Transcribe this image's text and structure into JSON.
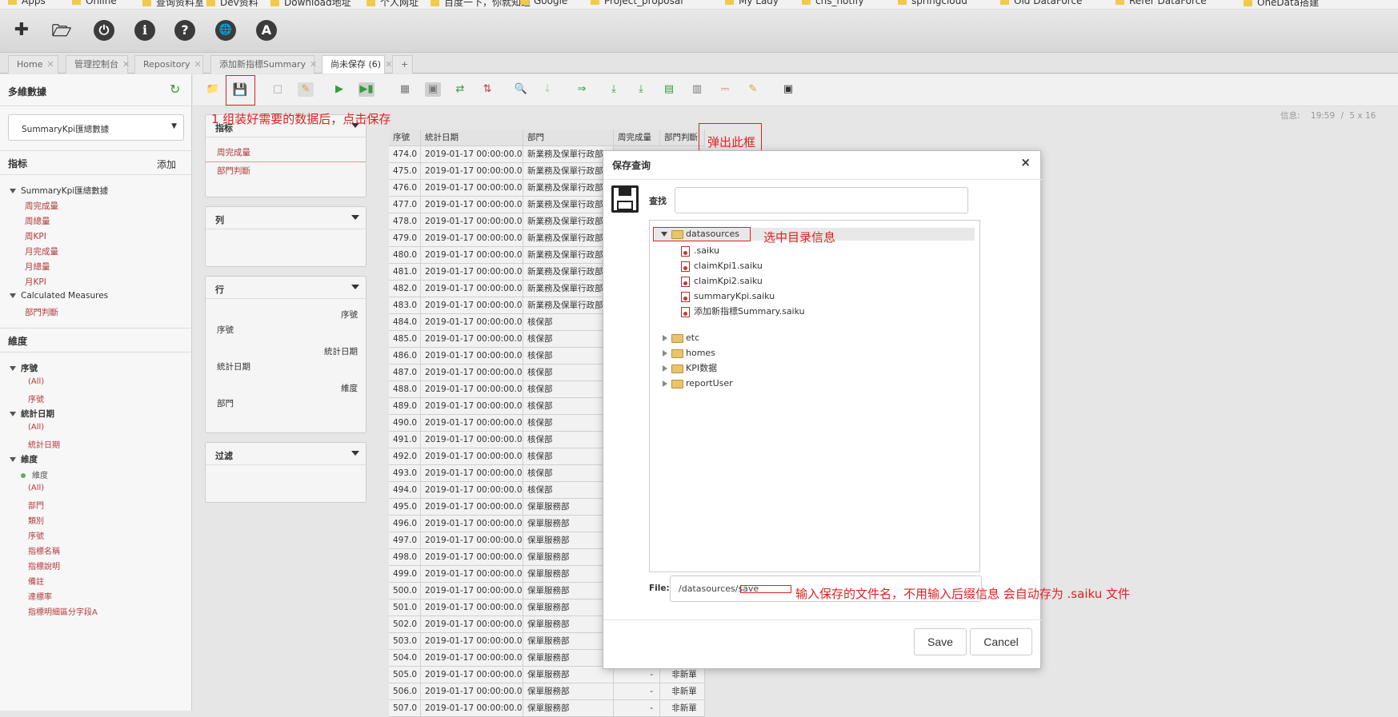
{
  "bookmarks": [
    "Apps",
    "Online",
    "查询资料室",
    "Dev资料",
    "Download地址",
    "个人网址",
    "百度一下，你就知道",
    "Google",
    "Project_proposal",
    "My Lady",
    "cns_notify",
    "springcloud",
    "Old DataForce",
    "Refer DataForce",
    "OneData搭建"
  ],
  "tabs": [
    {
      "label": "Home"
    },
    {
      "label": "管理控制台"
    },
    {
      "label": "Repository"
    },
    {
      "label": "添加新指標Summary"
    },
    {
      "label": "尚未保存 (6)"
    },
    {
      "label": "+"
    }
  ],
  "left": {
    "title": "多維數據",
    "cube_select": "SummaryKpi匯總數據",
    "measures_title": "指标",
    "add_label": "添加",
    "measures_group": "SummaryKpi匯總數據",
    "measures": [
      "周完成量",
      "周總量",
      "周KPI",
      "月完成量",
      "月總量",
      "月KPI"
    ],
    "calc_group": "Calculated Measures",
    "calc_items": [
      "部門判斷"
    ],
    "dims_title": "維度",
    "dims": [
      {
        "name": "序號",
        "items": [
          "(All)",
          "序號"
        ]
      },
      {
        "name": "統計日期",
        "items": [
          "(All)",
          "統計日期"
        ]
      },
      {
        "name": "維度",
        "items": [
          "維度",
          "(All)",
          "部門",
          "類別",
          "序號",
          "指標名稱",
          "指標說明",
          "備註",
          "達標率",
          "指標明細區分字段A"
        ]
      }
    ]
  },
  "panels": {
    "measures": {
      "title": "指标",
      "items": [
        "周完成量",
        "部門判斷"
      ]
    },
    "columns": {
      "title": "列"
    },
    "rows": {
      "title": "行",
      "items": [
        {
          "hier": "序號",
          "level": "序號"
        },
        {
          "hier": "統計日期",
          "level": "統計日期"
        },
        {
          "hier": "維度",
          "level": "部門"
        }
      ]
    },
    "filter": {
      "title": "过滤"
    }
  },
  "info": {
    "label": "信息:",
    "time": "19:59",
    "size": "5 x 16"
  },
  "grid": {
    "headers": [
      "序號",
      "統計日期",
      "部門",
      "周完成量",
      "部門判斷"
    ],
    "rows": [
      [
        "474.0",
        "2019-01-17 00:00:00.0",
        "新業務及保單行政部"
      ],
      [
        "475.0",
        "2019-01-17 00:00:00.0",
        "新業務及保單行政部"
      ],
      [
        "476.0",
        "2019-01-17 00:00:00.0",
        "新業務及保單行政部"
      ],
      [
        "477.0",
        "2019-01-17 00:00:00.0",
        "新業務及保單行政部"
      ],
      [
        "478.0",
        "2019-01-17 00:00:00.0",
        "新業務及保單行政部"
      ],
      [
        "479.0",
        "2019-01-17 00:00:00.0",
        "新業務及保單行政部"
      ],
      [
        "480.0",
        "2019-01-17 00:00:00.0",
        "新業務及保單行政部"
      ],
      [
        "481.0",
        "2019-01-17 00:00:00.0",
        "新業務及保單行政部"
      ],
      [
        "482.0",
        "2019-01-17 00:00:00.0",
        "新業務及保單行政部"
      ],
      [
        "483.0",
        "2019-01-17 00:00:00.0",
        "新業務及保單行政部"
      ],
      [
        "484.0",
        "2019-01-17 00:00:00.0",
        "核保部"
      ],
      [
        "485.0",
        "2019-01-17 00:00:00.0",
        "核保部"
      ],
      [
        "486.0",
        "2019-01-17 00:00:00.0",
        "核保部"
      ],
      [
        "487.0",
        "2019-01-17 00:00:00.0",
        "核保部"
      ],
      [
        "488.0",
        "2019-01-17 00:00:00.0",
        "核保部"
      ],
      [
        "489.0",
        "2019-01-17 00:00:00.0",
        "核保部"
      ],
      [
        "490.0",
        "2019-01-17 00:00:00.0",
        "核保部"
      ],
      [
        "491.0",
        "2019-01-17 00:00:00.0",
        "核保部"
      ],
      [
        "492.0",
        "2019-01-17 00:00:00.0",
        "核保部"
      ],
      [
        "493.0",
        "2019-01-17 00:00:00.0",
        "核保部"
      ],
      [
        "494.0",
        "2019-01-17 00:00:00.0",
        "核保部"
      ],
      [
        "495.0",
        "2019-01-17 00:00:00.0",
        "保單服務部"
      ],
      [
        "496.0",
        "2019-01-17 00:00:00.0",
        "保單服務部"
      ],
      [
        "497.0",
        "2019-01-17 00:00:00.0",
        "保單服務部"
      ],
      [
        "498.0",
        "2019-01-17 00:00:00.0",
        "保單服務部"
      ],
      [
        "499.0",
        "2019-01-17 00:00:00.0",
        "保單服務部"
      ],
      [
        "500.0",
        "2019-01-17 00:00:00.0",
        "保單服務部"
      ],
      [
        "501.0",
        "2019-01-17 00:00:00.0",
        "保單服務部"
      ],
      [
        "502.0",
        "2019-01-17 00:00:00.0",
        "保單服務部"
      ],
      [
        "503.0",
        "2019-01-17 00:00:00.0",
        "保單服務部"
      ],
      [
        "504.0",
        "2019-01-17 00:00:00.0",
        "保單服務部"
      ],
      [
        "505.0",
        "2019-01-17 00:00:00.0",
        "保單服務部",
        "-",
        "非新單"
      ],
      [
        "506.0",
        "2019-01-17 00:00:00.0",
        "保單服務部",
        "-",
        "非新單"
      ],
      [
        "507.0",
        "2019-01-17 00:00:00.0",
        "保單服務部",
        "-",
        "非新單"
      ]
    ]
  },
  "dialog": {
    "title": "保存查询",
    "close": "×",
    "search_label": "查找",
    "search_value": "",
    "tree": {
      "root": "datasources",
      "files": [
        ".saiku",
        "claimKpi1.saiku",
        "claimKpi2.saiku",
        "summaryKpi.saiku",
        "添加新指標Summary.saiku"
      ],
      "folders": [
        "etc",
        "homes",
        "KPI数据",
        "reportUser"
      ]
    },
    "file_label": "File:",
    "file_value": "/datasources/save",
    "save_label": "Save",
    "cancel_label": "Cancel"
  },
  "annotations": {
    "a1": "1 组装好需要的数据后，点击保存",
    "a2": "弹出此框",
    "a3": "选中目录信息",
    "a4": "输入保存的文件名，不用输入后缀信息 会自动存为 .saiku 文件"
  },
  "colors": {
    "annotation": "#e02020",
    "measure_text": "#b23a3a"
  }
}
